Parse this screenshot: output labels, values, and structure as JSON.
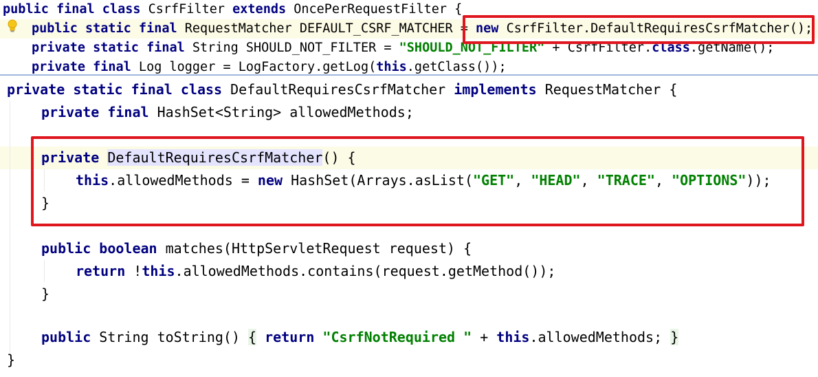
{
  "icons": {
    "intention_bulb": "lightbulb-icon"
  },
  "colors": {
    "annotation_box": "#e0161f",
    "keyword": "#000080",
    "string": "#008000",
    "field": "#660e7a"
  },
  "top": {
    "l1": {
      "a": "public final class",
      "b": " CsrfFilter ",
      "c": "extends",
      "d": " OncePerRequestFilter {"
    },
    "l2": {
      "a": "public static final",
      "b": " RequestMatcher ",
      "c": "DEFAULT_CSRF_MATCHER",
      "d": " = ",
      "e": "new",
      "f": " CsrfFilter.DefaultRequiresCsrfMatcher();"
    },
    "l3": {
      "a": "private static final",
      "b": " String ",
      "c": "SHOULD_NOT_FILTER",
      "d": " = ",
      "e": "\"SHOULD_NOT_FILTER\"",
      "f": " + CsrfFilter.",
      "g": "class",
      "h": ".getName();"
    },
    "l4": {
      "a": "private final",
      "b": " Log ",
      "c": "logger",
      "d": " = LogFactory.getLog(",
      "e": "this",
      "f": ".getClass());"
    }
  },
  "bottom": {
    "l1": {
      "a": "private static final class",
      "b": " DefaultRequiresCsrfMatcher ",
      "c": "implements",
      "d": " RequestMatcher {"
    },
    "l2": {
      "a": "private final",
      "b": " HashSet<String> ",
      "c": "allowedMethods",
      "d": ";"
    },
    "l3": {
      "a": "private",
      "b": " ",
      "c": "DefaultRequiresCsrfMatcher",
      "d": "() {"
    },
    "l4": {
      "a": "this",
      "b": ".",
      "c": "allowedMethods",
      "d": " = ",
      "e": "new",
      "f": " HashSet(Arrays.asList(",
      "g": "\"GET\"",
      "h": ", ",
      "i": "\"HEAD\"",
      "j": ", ",
      "k": "\"TRACE\"",
      "l": ", ",
      "m": "\"OPTIONS\"",
      "n": "));"
    },
    "l5": {
      "a": "}"
    },
    "l6": {
      "a": "public boolean",
      "b": " matches(HttpServletRequest request) {"
    },
    "l7": {
      "a": "return",
      "b": " !",
      "c": "this",
      "d": ".",
      "e": "allowedMethods",
      "f": ".contains(request.getMethod());"
    },
    "l8": {
      "a": "}"
    },
    "l9": {
      "a": "public",
      "b": " String toString() ",
      "c": "{",
      "d": " ",
      "e": "return",
      "f": " ",
      "g": "\"CsrfNotRequired \"",
      "h": " + ",
      "i": "this",
      "j": ".",
      "k": "allowedMethods",
      "l": "; ",
      "m": "}"
    },
    "l10": {
      "a": "}"
    }
  }
}
